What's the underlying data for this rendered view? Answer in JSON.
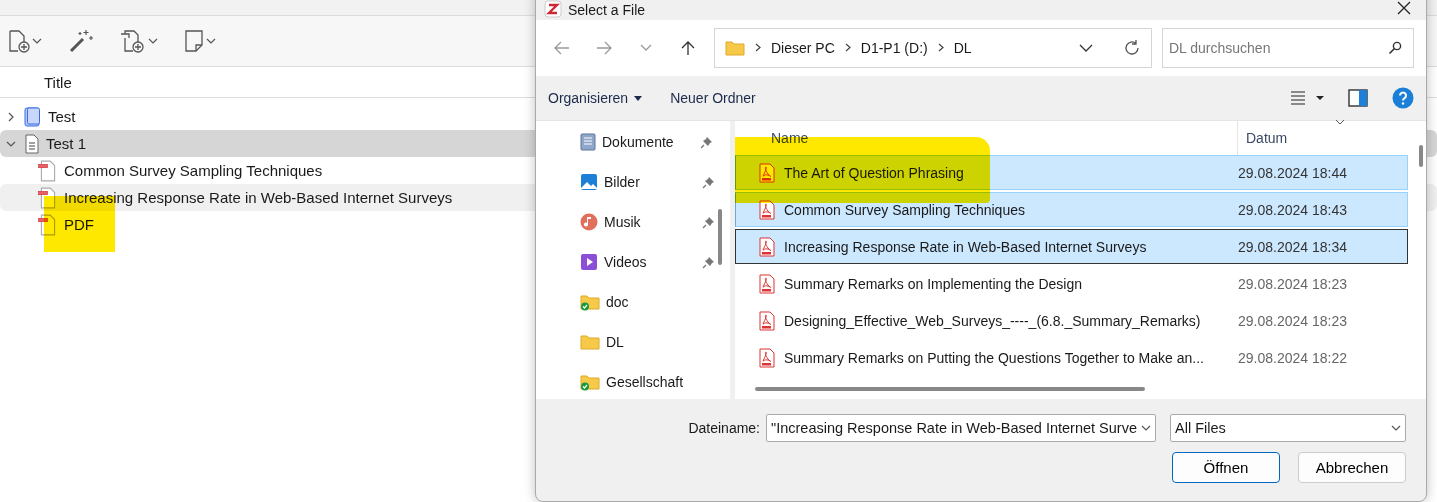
{
  "library": {
    "toolbar": [
      {
        "kind": "new-item",
        "menu": true
      },
      {
        "kind": "wand",
        "menu": false
      },
      {
        "kind": "add-attachment",
        "menu": true
      },
      {
        "kind": "note",
        "menu": true
      }
    ],
    "columns": [
      "Title"
    ],
    "rows": [
      {
        "title": "Test",
        "kind": "book",
        "expanded": false,
        "selected": false,
        "children": []
      },
      {
        "title": "Test 1",
        "kind": "document",
        "expanded": true,
        "selected": true,
        "children": [
          {
            "title": "Common Survey Sampling Techniques",
            "kind": "pdf",
            "selected": false,
            "hovered": false,
            "marked": false
          },
          {
            "title": "Increasing Response Rate in Web-Based Internet Surveys",
            "kind": "pdf",
            "selected": false,
            "hovered": true,
            "marked": false
          },
          {
            "title": "PDF",
            "kind": "pdf",
            "selected": false,
            "hovered": false,
            "marked": true
          }
        ]
      }
    ]
  },
  "dialog": {
    "title": "Select a File",
    "path": [
      "Dieser PC",
      "D1-P1 (D:)",
      "DL"
    ],
    "search": {
      "placeholder": "DL durchsuchen"
    },
    "commands": [
      {
        "label": "Organisieren",
        "menu": true
      },
      {
        "label": "Neuer Ordner",
        "menu": false
      }
    ],
    "nav": [
      {
        "label": "Dokumente",
        "kind": "documents",
        "pinned": true
      },
      {
        "label": "Bilder",
        "kind": "pictures",
        "pinned": true
      },
      {
        "label": "Musik",
        "kind": "music",
        "pinned": true
      },
      {
        "label": "Videos",
        "kind": "videos",
        "pinned": true
      },
      {
        "label": "doc",
        "kind": "folder-synced",
        "pinned": false
      },
      {
        "label": "DL",
        "kind": "folder",
        "pinned": false
      },
      {
        "label": "Gesellschaft",
        "kind": "folder-synced",
        "pinned": false
      }
    ],
    "columns": [
      "Name",
      "Datum"
    ],
    "files": [
      {
        "name": "The Art of Question Phrasing",
        "date": "29.08.2024 18:44",
        "selected": true,
        "focused": false,
        "marked": true
      },
      {
        "name": "Common Survey Sampling Techniques",
        "date": "29.08.2024 18:43",
        "selected": true,
        "focused": false,
        "marked": false
      },
      {
        "name": "Increasing Response Rate in Web-Based Internet Surveys",
        "date": "29.08.2024 18:34",
        "selected": true,
        "focused": true,
        "marked": false
      },
      {
        "name": "Summary Remarks on Implementing the Design",
        "date": "29.08.2024 18:23",
        "selected": false,
        "focused": false,
        "marked": false
      },
      {
        "name": "Designing_Effective_Web_Surveys_----_(6.8._Summary_Remarks)",
        "date": "29.08.2024 18:23",
        "selected": false,
        "focused": false,
        "marked": false
      },
      {
        "name": "Summary Remarks on  Putting the Questions Together to Make an...",
        "date": "29.08.2024 18:22",
        "selected": false,
        "focused": false,
        "marked": false
      }
    ],
    "filename_label": "Dateiname:",
    "filename": "\"Increasing Response Rate in Web-Based Internet Surve",
    "filter": "All Files",
    "buttons": [
      {
        "label": "Öffnen",
        "default": true
      },
      {
        "label": "Abbrechen",
        "default": false
      }
    ]
  }
}
